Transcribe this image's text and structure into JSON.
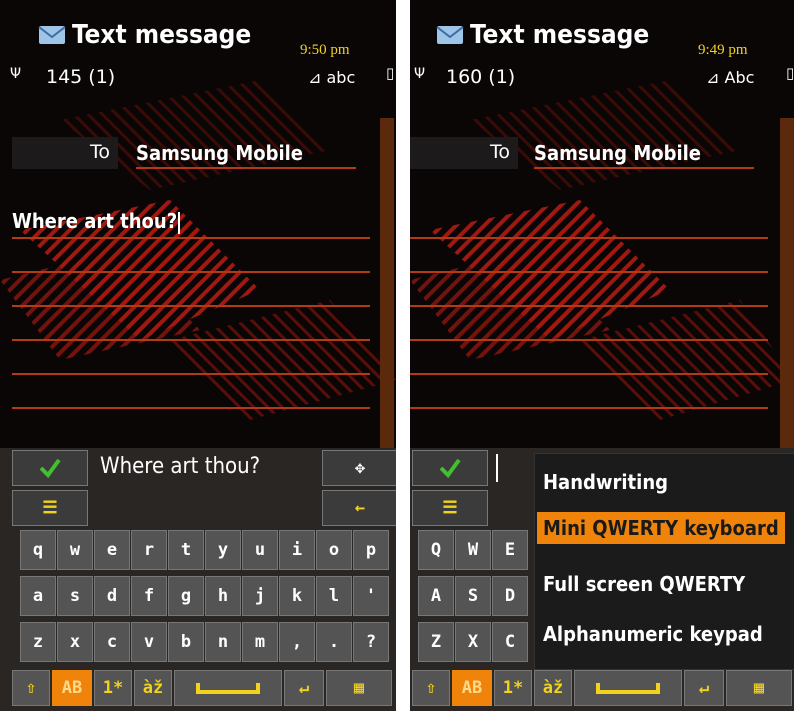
{
  "colors": {
    "accent": "#f0840a",
    "time": "#f3d21c",
    "line": "#b23a14",
    "bg": "#0a0606"
  },
  "left": {
    "title": "Text message",
    "time": "9:50 pm",
    "signal_icon": "antenna-icon",
    "counter": "145 (1)",
    "input_mode": "abc",
    "to_label": "To",
    "recipient": "Samsung Mobile",
    "message": "Where art thou?",
    "prediction": "Where art thou?",
    "keys_row1": [
      "q",
      "w",
      "e",
      "r",
      "t",
      "y",
      "u",
      "i",
      "o",
      "p"
    ],
    "keys_row2": [
      "a",
      "s",
      "d",
      "f",
      "g",
      "h",
      "j",
      "k",
      "l",
      "'"
    ],
    "keys_row3": [
      "z",
      "x",
      "c",
      "v",
      "b",
      "n",
      "m",
      ",",
      ".",
      "?"
    ],
    "bottom": {
      "case": "AB",
      "num": "1*",
      "accent": "àž"
    }
  },
  "right": {
    "title": "Text message",
    "time": "9:49 pm",
    "counter": "160 (1)",
    "input_mode": "Abc",
    "to_label": "To",
    "recipient": "Samsung Mobile",
    "keys_row1": [
      "Q",
      "W",
      "E"
    ],
    "keys_row2": [
      "A",
      "S",
      "D"
    ],
    "keys_row3": [
      "Z",
      "X",
      "C"
    ],
    "bottom": {
      "case": "AB",
      "num": "1*",
      "accent": "àž"
    },
    "menu": [
      "Handwriting",
      "Mini QWERTY keyboard",
      "Full screen QWERTY",
      "Alphanumeric keypad"
    ],
    "menu_selected": "Mini QWERTY keyboard"
  }
}
